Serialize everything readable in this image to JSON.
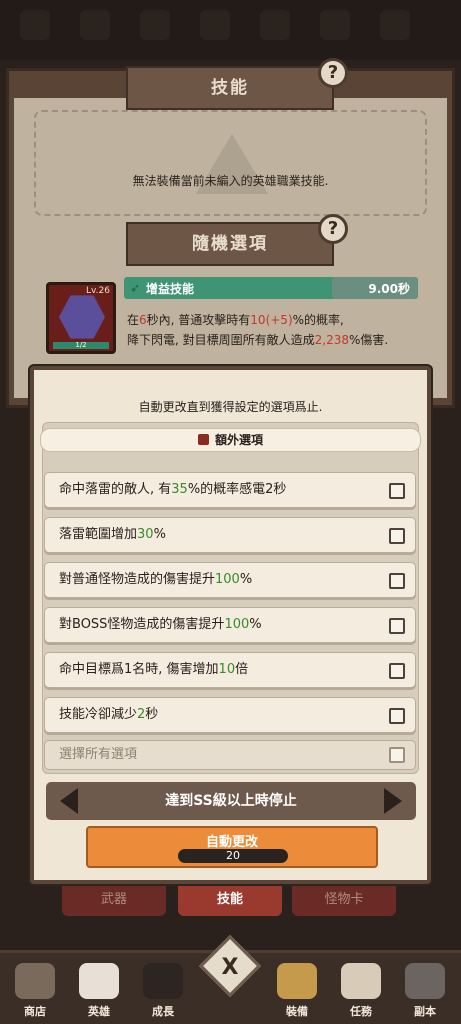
{
  "underlying": {
    "skill_title": "技能",
    "skill_help": "?",
    "skill_empty_message": "無法裝備當前未編入的英雄職業技能.",
    "random_title": "隨機選項",
    "random_help": "?",
    "skill_card": {
      "level": "Lv.26",
      "count": "1/2",
      "type_label": "增益技能",
      "cooldown": "9.00秒",
      "desc_line1_a": "在",
      "desc_line1_b": "6",
      "desc_line1_c": "秒內, 普通攻擊時有",
      "desc_line1_d": "10(+5)",
      "desc_line1_e": "%的概率,",
      "desc_line2_a": "降下閃電, 對目標周圍所有敵人造成",
      "desc_line2_b": "2,238",
      "desc_line2_c": "%傷害."
    }
  },
  "popup": {
    "message": "自動更改直到獲得設定的選項爲止.",
    "header": "額外選項",
    "options": [
      {
        "a": "命中落雷的敵人, 有",
        "b": "35",
        "c": "%的概率感電2秒"
      },
      {
        "a": "落雷範圍增加",
        "b": "30",
        "c": "%"
      },
      {
        "a": "對普通怪物造成的傷害提升",
        "b": "100",
        "c": "%"
      },
      {
        "a": "對BOSS怪物造成的傷害提升",
        "b": "100",
        "c": "%"
      },
      {
        "a": "命中目標爲1名時, 傷害增加",
        "b": "10",
        "c": "倍"
      },
      {
        "a": "技能冷卻減少",
        "b": "2",
        "c": "秒"
      }
    ],
    "select_all": "選擇所有選項",
    "stop_condition": "達到SS級以上時停止",
    "auto_button": "自動更改",
    "auto_count": "20"
  },
  "tabs": [
    "武器",
    "技能",
    "怪物卡"
  ],
  "nav": {
    "close": "X",
    "items": [
      "商店",
      "英雄",
      "成長",
      "裝備",
      "任務",
      "副本"
    ]
  }
}
